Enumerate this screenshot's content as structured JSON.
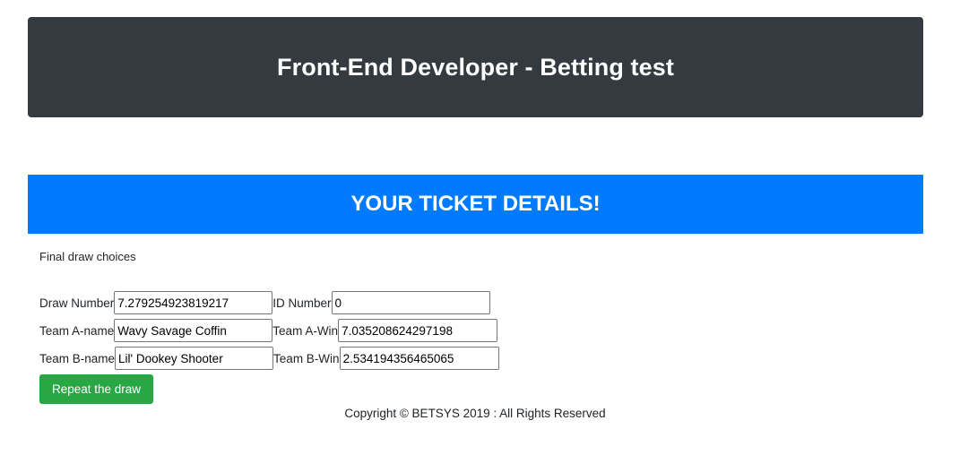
{
  "header": {
    "title": "Front-End Developer - Betting test"
  },
  "ticket": {
    "banner": "YOUR TICKET DETAILS!",
    "subtitle": "Final draw choices",
    "fields": {
      "draw_number_label": "Draw Number",
      "draw_number_value": "7.279254923819217",
      "id_number_label": "ID Number",
      "id_number_value": "0",
      "team_a_name_label": "Team A-name",
      "team_a_name_value": "Wavy Savage Coffin",
      "team_a_win_label": "Team A-Win",
      "team_a_win_value": "7.035208624297198",
      "team_b_name_label": "Team B-name",
      "team_b_name_value": "Lil' Dookey Shooter",
      "team_b_win_label": "Team B-Win",
      "team_b_win_value": "2.534194356465065"
    },
    "repeat_button": "Repeat the draw"
  },
  "footer": {
    "copyright": "Copyright © BETSYS 2019 : All Rights Reserved"
  },
  "colors": {
    "header_bg": "#343a40",
    "banner_bg": "#007bff",
    "button_bg": "#28a745"
  }
}
